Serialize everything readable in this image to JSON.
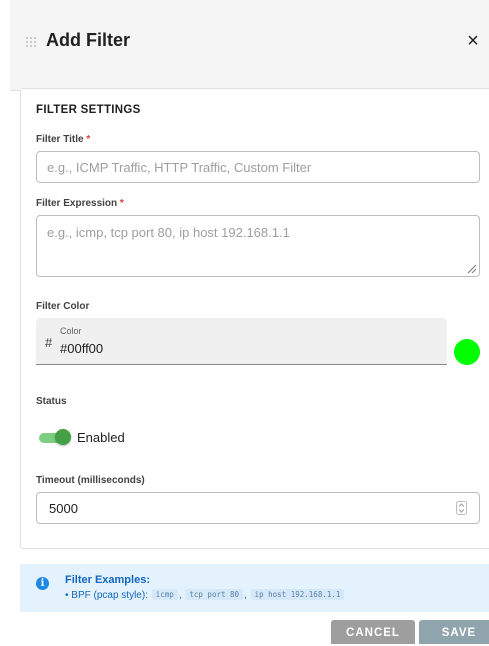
{
  "dialog": {
    "title": "Add Filter",
    "close_label": "×"
  },
  "form": {
    "section_title": "FILTER SETTINGS",
    "filter_title": {
      "label": "Filter Title",
      "required_marker": "*",
      "value": "",
      "placeholder": "e.g., ICMP Traffic, HTTP Traffic, Custom Filter"
    },
    "filter_expression": {
      "label": "Filter Expression",
      "required_marker": "*",
      "value": "",
      "placeholder": "e.g., icmp, tcp port 80, ip host 192.168.1.1"
    },
    "filter_color": {
      "label": "Filter Color",
      "prefix": "#",
      "sublabel": "Color",
      "value": "#00ff00",
      "swatch_color": "#00ff00"
    },
    "status": {
      "label": "Status",
      "toggle_label": "Enabled",
      "enabled": true
    },
    "timeout": {
      "label": "Timeout (milliseconds)",
      "value": "5000"
    }
  },
  "info": {
    "icon": "info-icon",
    "title": "Filter Examples:",
    "prefix": "• BPF (pcap style):",
    "examples": [
      "icmp",
      "tcp port 80",
      "ip host 192.168.1.1"
    ],
    "separator": ","
  },
  "actions": {
    "cancel_label": "CANCEL",
    "save_label": "SAVE"
  },
  "colors": {
    "accent_green": "#43a047",
    "info_blue": "#1565c0",
    "required_red": "#e53935",
    "cancel_gray": "#9e9e9e",
    "save_disabled": "#90a4ae"
  },
  "icons": [
    "drag-handle-icon",
    "close-icon",
    "resize-grip-icon",
    "spin-arrows-icon",
    "info-icon"
  ]
}
